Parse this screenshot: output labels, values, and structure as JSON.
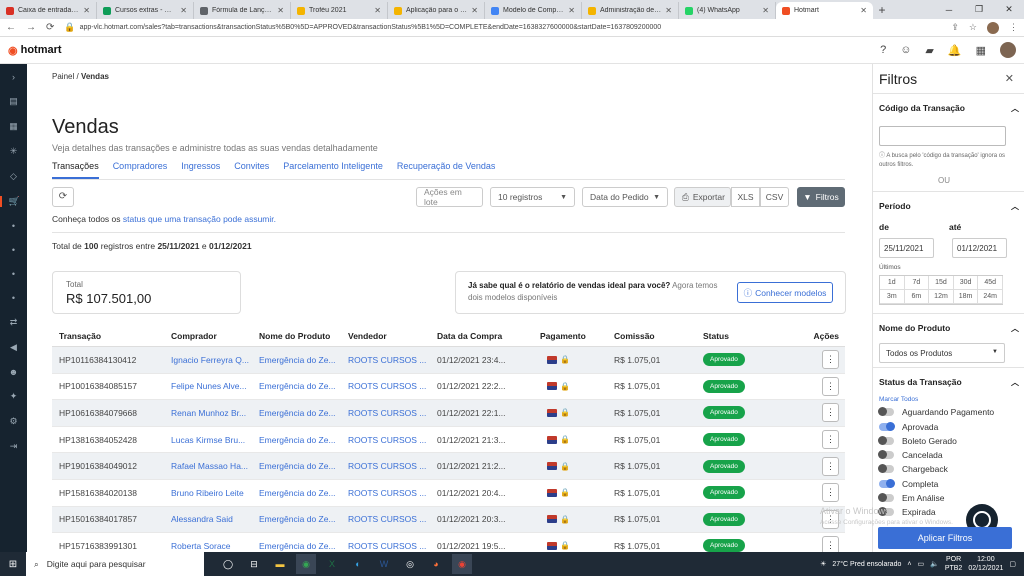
{
  "browser": {
    "tabs": [
      {
        "label": "Caixa de entrada (269...",
        "color": "#d93025",
        "icon": "gmail-icon"
      },
      {
        "label": "Cursos extras - Google...",
        "color": "#0f9d58",
        "icon": "drive-icon"
      },
      {
        "label": "Fórmula de Lançamen...",
        "color": "#5f6368",
        "icon": "globe-icon"
      },
      {
        "label": "Troféu 2021",
        "color": "#f4b400",
        "icon": "trophy-icon"
      },
      {
        "label": "Aplicação para o Trofé...",
        "color": "#f4b400",
        "icon": "trophy-icon"
      },
      {
        "label": "Modelo de Comprova...",
        "color": "#4285f4",
        "icon": "docs-icon"
      },
      {
        "label": "Administração de do...",
        "color": "#f4b400",
        "icon": "admin-icon"
      },
      {
        "label": "(4) WhatsApp",
        "color": "#25d366",
        "icon": "whatsapp-icon"
      },
      {
        "label": "Hotmart",
        "color": "#f04e23",
        "icon": "hotmart-icon"
      }
    ],
    "active_tab": 8,
    "new_tab": "+",
    "url": "app-vlc.hotmart.com/sales?tab=transactions&transactionStatus%5B0%5D=APPROVED&transactionStatus%5B1%5D=COMPLETE&endDate=1638327600000&startDate=1637809200000"
  },
  "app": {
    "logo_text": "hotmart"
  },
  "breadcrumb": {
    "root": "Painel",
    "sep": "/",
    "current": "Vendas"
  },
  "page": {
    "title": "Vendas",
    "subtitle": "Veja detalhes das transações e administre todas as suas vendas detalhadamente"
  },
  "tabs": [
    "Transações",
    "Compradores",
    "Ingressos",
    "Convites",
    "Parcelamento Inteligente",
    "Recuperação de Vendas"
  ],
  "toolbar": {
    "acoes": "Ações em lote",
    "registros": "10 registros",
    "data": "Data do Pedido",
    "exportar": "Exportar",
    "xls": "XLS",
    "csv": "CSV",
    "filtros": "Filtros"
  },
  "status_info": {
    "before": "Conheça todos os",
    "link": "status que uma transação pode assumir."
  },
  "range_info": {
    "p1": "Total de",
    "count": "100",
    "p2": "registros entre",
    "start": "25/11/2021",
    "p3": "e",
    "end": "01/12/2021"
  },
  "total": {
    "label": "Total",
    "value": "R$ 107.501,00"
  },
  "report": {
    "bold": "Já sabe qual é o relatório de vendas ideal para você?",
    "text": "Agora temos dois modelos disponíveis",
    "button": "Conhecer modelos"
  },
  "table": {
    "headers": [
      "Transação",
      "Comprador",
      "Nome do Produto",
      "Vendedor",
      "Data da Compra",
      "Pagamento",
      "Comissão",
      "Status",
      "Ações"
    ],
    "rows": [
      {
        "id": "HP10116384130412",
        "buyer": "Ignacio Ferreyra Q...",
        "product": "Emergência do Ze...",
        "seller": "ROOTS CURSOS ...",
        "date": "01/12/2021 23:4...",
        "commission": "R$ 1.075,01",
        "status": "Aprovado"
      },
      {
        "id": "HP10016384085157",
        "buyer": "Felipe Nunes Alve...",
        "product": "Emergência do Ze...",
        "seller": "ROOTS CURSOS ...",
        "date": "01/12/2021 22:2...",
        "commission": "R$ 1.075,01",
        "status": "Aprovado"
      },
      {
        "id": "HP10616384079668",
        "buyer": "Renan Munhoz Br...",
        "product": "Emergência do Ze...",
        "seller": "ROOTS CURSOS ...",
        "date": "01/12/2021 22:1...",
        "commission": "R$ 1.075,01",
        "status": "Aprovado"
      },
      {
        "id": "HP13816384052428",
        "buyer": "Lucas Kirmse Bru...",
        "product": "Emergência do Ze...",
        "seller": "ROOTS CURSOS ...",
        "date": "01/12/2021 21:3...",
        "commission": "R$ 1.075,01",
        "status": "Aprovado"
      },
      {
        "id": "HP19016384049012",
        "buyer": "Rafael Massao Ha...",
        "product": "Emergência do Ze...",
        "seller": "ROOTS CURSOS ...",
        "date": "01/12/2021 21:2...",
        "commission": "R$ 1.075,01",
        "status": "Aprovado"
      },
      {
        "id": "HP15816384020138",
        "buyer": "Bruno Ribeiro Leite",
        "product": "Emergência do Ze...",
        "seller": "ROOTS CURSOS ...",
        "date": "01/12/2021 20:4...",
        "commission": "R$ 1.075,01",
        "status": "Aprovado"
      },
      {
        "id": "HP15016384017857",
        "buyer": "Alessandra Said",
        "product": "Emergência do Ze...",
        "seller": "ROOTS CURSOS ...",
        "date": "01/12/2021 20:3...",
        "commission": "R$ 1.075,01",
        "status": "Aprovado"
      },
      {
        "id": "HP15716383991301",
        "buyer": "Roberta Sorace",
        "product": "Emergência do Ze...",
        "seller": "ROOTS CURSOS ...",
        "date": "01/12/2021 19:5...",
        "commission": "R$ 1.075,01",
        "status": "Aprovado"
      }
    ]
  },
  "filters": {
    "title": "Filtros",
    "codigo": {
      "label": "Código da Transação",
      "help": "A busca pelo 'código da transação' ignora os outros filtros.",
      "or": "OU"
    },
    "periodo": {
      "label": "Período",
      "de": "de",
      "ate": "até",
      "start": "25/11/2021",
      "end": "01/12/2021",
      "ultimos": "Últimos",
      "ranges": [
        "1d",
        "7d",
        "15d",
        "30d",
        "45d",
        "3m",
        "6m",
        "12m",
        "18m",
        "24m"
      ]
    },
    "produto": {
      "label": "Nome do Produto",
      "value": "Todos os Produtos"
    },
    "status": {
      "label": "Status da Transação",
      "marcar_todos": "Marcar Todos",
      "items": [
        {
          "label": "Aguardando Pagamento",
          "on": false
        },
        {
          "label": "Aprovada",
          "on": true
        },
        {
          "label": "Boleto Gerado",
          "on": false
        },
        {
          "label": "Cancelada",
          "on": false
        },
        {
          "label": "Chargeback",
          "on": false
        },
        {
          "label": "Completa",
          "on": true
        },
        {
          "label": "Em Análise",
          "on": false
        },
        {
          "label": "Expirada",
          "on": false
        }
      ]
    },
    "apply": "Aplicar Filtros"
  },
  "watermark": {
    "title": "Ativar o Windows",
    "sub": "Acesse Configurações para ativar o Windows."
  },
  "taskbar": {
    "search_placeholder": "Digite aqui para pesquisar",
    "weather": "27°C  Pred ensolarado",
    "lang1": "POR",
    "lang2": "PTB2",
    "time": "12:00",
    "date": "02/12/2021"
  }
}
